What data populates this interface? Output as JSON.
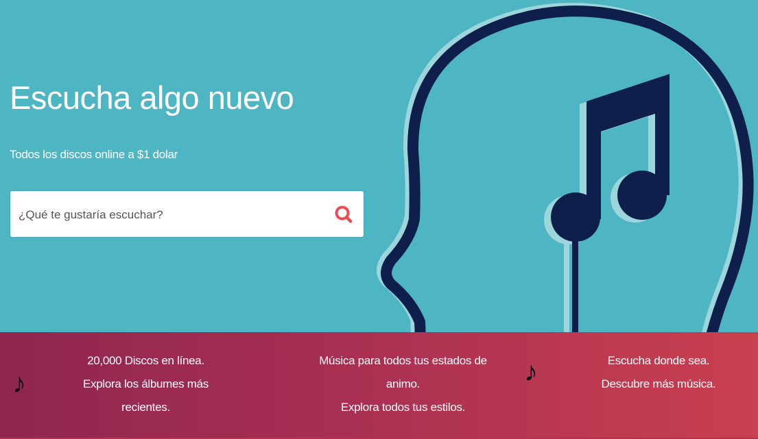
{
  "hero": {
    "title": "Escucha algo nuevo",
    "subtitle": "Todos los discos online a $1 dolar",
    "search": {
      "placeholder": "¿Qué te gustaría escuchar?",
      "value": "",
      "icon": "search-icon"
    }
  },
  "features": [
    {
      "lines": [
        "20,000 Discos en línea.",
        "Explora los álbumes más",
        "recientes."
      ]
    },
    {
      "lines": [
        "Música para todos tus estados de",
        "animo.",
        "Explora todos tus estilos."
      ]
    },
    {
      "lines": [
        "Escucha donde sea.",
        "Descubre más música."
      ]
    }
  ],
  "icons": {
    "note": "♪",
    "note2": "𝅘𝅥𝅯"
  },
  "colors": {
    "hero_bg": "#4db6c2",
    "outline_dark": "#0f1f4b",
    "outline_light": "#9dd5dc",
    "band_start": "#8f2650",
    "band_end": "#c9404f",
    "search_icon": "#f0494f"
  }
}
